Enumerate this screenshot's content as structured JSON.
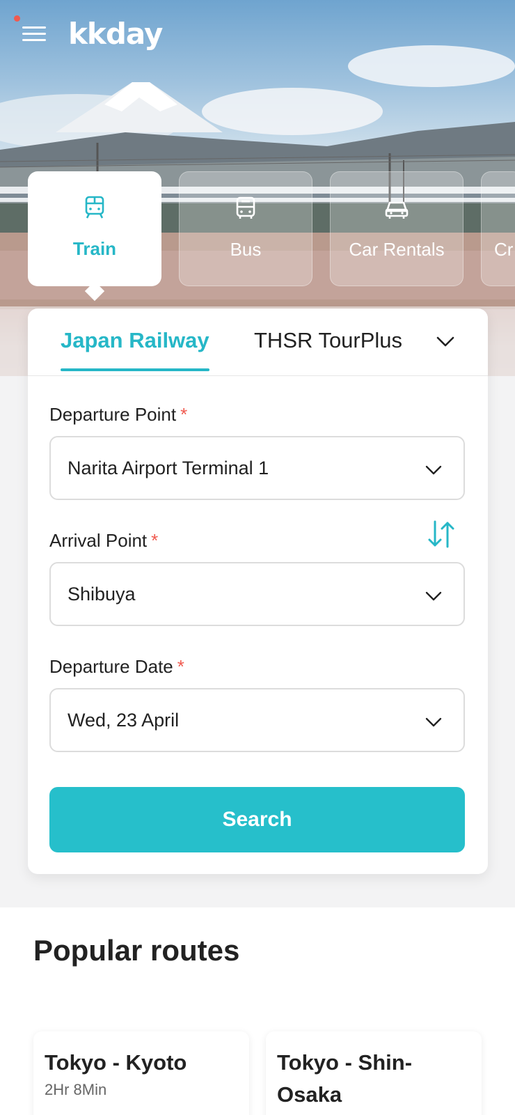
{
  "brand": {
    "logo": "kkday"
  },
  "colors": {
    "accent": "#26b7c7",
    "button": "#26bfcb",
    "required": "#f05a4f"
  },
  "categories": [
    {
      "label": "Train",
      "icon": "train-icon",
      "active": true
    },
    {
      "label": "Bus",
      "icon": "bus-icon",
      "active": false
    },
    {
      "label": "Car Rentals",
      "icon": "car-icon",
      "active": false
    },
    {
      "label": "Cr",
      "icon": "cruise-icon",
      "active": false
    }
  ],
  "subtabs": {
    "active": "Japan Railway",
    "other": "THSR TourPlus"
  },
  "form": {
    "departure": {
      "label": "Departure Point",
      "required": "*",
      "value": "Narita Airport Terminal 1"
    },
    "arrival": {
      "label": "Arrival Point",
      "required": "*",
      "value": "Shibuya"
    },
    "date": {
      "label": "Departure Date",
      "required": "*",
      "value": "Wed, 23 April"
    },
    "search_label": "Search"
  },
  "popular": {
    "title": "Popular routes",
    "routes": [
      {
        "name": "Tokyo - Kyoto",
        "duration": "2Hr 8Min"
      },
      {
        "name": "Tokyo - Shin-Osaka",
        "duration": ""
      }
    ]
  }
}
